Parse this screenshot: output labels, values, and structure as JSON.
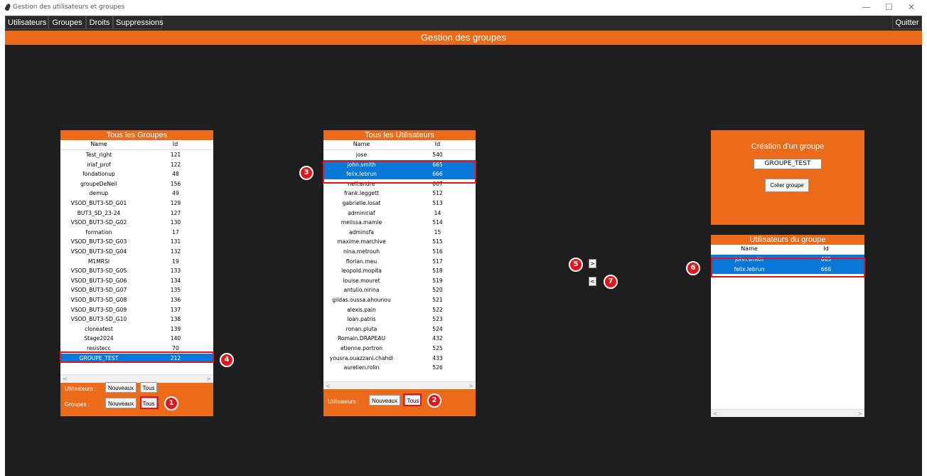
{
  "window": {
    "title": "Gestion des utilisateurs et groupes",
    "controls": [
      "—",
      "☐",
      "✕"
    ]
  },
  "menu": {
    "items": [
      "Utilisateurs",
      "Groupes",
      "Droits",
      "Suppressions"
    ],
    "quit": "Quitter"
  },
  "header": {
    "title": "Gestion des groupes"
  },
  "groups_panel": {
    "title": "Tous les Groupes",
    "columns": [
      "Name",
      "Id"
    ],
    "rows": [
      [
        "Test_right",
        "121"
      ],
      [
        "iriaf_prof",
        "122"
      ],
      [
        "fondationup",
        "48"
      ],
      [
        "groupeDeNeil",
        "156"
      ],
      [
        "demup",
        "49"
      ],
      [
        "VSOD_BUT3-SD_G01",
        "129"
      ],
      [
        "BUT3_SD_23-24",
        "127"
      ],
      [
        "VSOD_BUT3-SD_G02",
        "130"
      ],
      [
        "formation",
        "17"
      ],
      [
        "VSOD_BUT3-SD_G03",
        "131"
      ],
      [
        "VSOD_BUT3-SD_G04",
        "132"
      ],
      [
        "M1MRSI",
        "19"
      ],
      [
        "VSOD_BUT3-SD_G05",
        "133"
      ],
      [
        "VSOD_BUT3-SD_G06",
        "134"
      ],
      [
        "VSOD_BUT3-SD_G07",
        "135"
      ],
      [
        "VSOD_BUT3-SD_G08",
        "136"
      ],
      [
        "VSOD_BUT3-SD_G09",
        "137"
      ],
      [
        "VSOD_BUT3-SD_G10",
        "138"
      ],
      [
        "cloneatest",
        "139"
      ],
      [
        "Stage2024",
        "140"
      ],
      [
        "resistecc",
        "70"
      ],
      [
        "GROUPE_TEST",
        "212"
      ]
    ],
    "selected_index": 21,
    "users_label": "Utilisateurs :",
    "groups_label": "Groupes :",
    "btn_new": "Nouveaux",
    "btn_all": "Tous"
  },
  "users_panel": {
    "title": "Tous les Utilisateurs",
    "columns": [
      "Name",
      "Id"
    ],
    "rows": [
      [
        "jose",
        "540"
      ],
      [
        "john.smith",
        "665"
      ],
      [
        "felix.lebrun",
        "666"
      ],
      [
        "neil.andre",
        "667"
      ],
      [
        "frank.leggett",
        "512"
      ],
      [
        "gabrielle.losat",
        "513"
      ],
      [
        "adminiriaf",
        "14"
      ],
      [
        "melissa.mamie",
        "514"
      ],
      [
        "adminsfa",
        "15"
      ],
      [
        "maxime.marchive",
        "515"
      ],
      [
        "nina.metrouh",
        "516"
      ],
      [
        "florian.meu",
        "517"
      ],
      [
        "leopold.mopita",
        "518"
      ],
      [
        "louise.mouret",
        "519"
      ],
      [
        "antulio.nirina",
        "520"
      ],
      [
        "gildas.oussa.ahounou",
        "521"
      ],
      [
        "alexis.pain",
        "522"
      ],
      [
        "loan.patris",
        "523"
      ],
      [
        "ronan.pluta",
        "524"
      ],
      [
        "Romain.DRAPEAU",
        "432"
      ],
      [
        "etienne.portron",
        "525"
      ],
      [
        "yousra.ouazzani.chahdi",
        "433"
      ],
      [
        "aurelien.rolin",
        "526"
      ]
    ],
    "selected_indices": [
      1,
      2
    ],
    "users_label": "Utilisateurs :",
    "btn_new": "Nouveaux",
    "btn_all": "Tous"
  },
  "create_panel": {
    "title": "Création d'un groupe",
    "entry_value": "GROUPE_TEST",
    "button": "Créer groupe"
  },
  "members_panel": {
    "title": "Utilisateurs du groupe",
    "columns": [
      "Name",
      "Id"
    ],
    "rows": [
      [
        "john.smith",
        "665"
      ],
      [
        "felix.lebrun",
        "666"
      ]
    ]
  },
  "transfer": {
    "add": ">",
    "remove": "<"
  },
  "annotations": [
    "1",
    "2",
    "3",
    "4",
    "5",
    "6",
    "7"
  ],
  "colors": {
    "accent": "#ec6b1a",
    "selection": "#0a78d7",
    "highlight": "#e3141c",
    "background": "#1e1e1e"
  }
}
